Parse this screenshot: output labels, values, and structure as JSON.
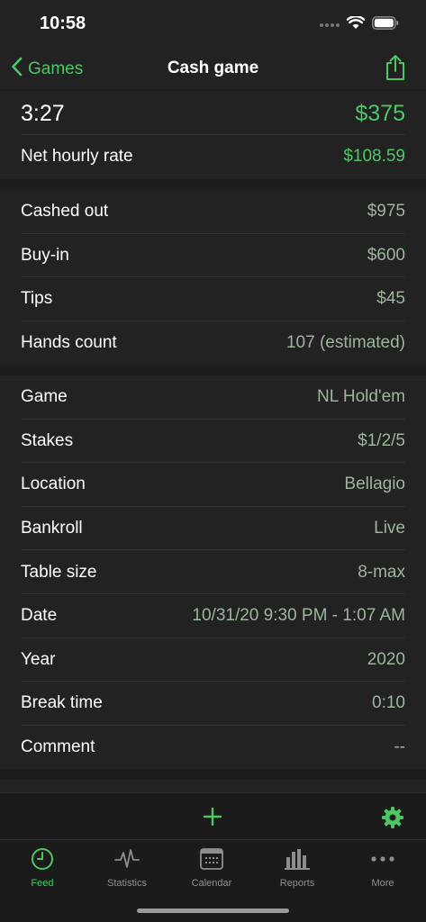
{
  "status_bar": {
    "time": "10:58"
  },
  "nav": {
    "back_label": "Games",
    "title": "Cash game"
  },
  "summary": {
    "duration": "3:27",
    "profit": "$375",
    "hourly_label": "Net hourly rate",
    "hourly_value": "$108.59"
  },
  "money": [
    {
      "label": "Cashed out",
      "value": "$975"
    },
    {
      "label": "Buy-in",
      "value": "$600"
    },
    {
      "label": "Tips",
      "value": "$45"
    },
    {
      "label": "Hands count",
      "value": "107 (estimated)"
    }
  ],
  "details": [
    {
      "label": "Game",
      "value": "NL Hold'em"
    },
    {
      "label": "Stakes",
      "value": "$1/2/5"
    },
    {
      "label": "Location",
      "value": "Bellagio"
    },
    {
      "label": "Bankroll",
      "value": "Live"
    },
    {
      "label": "Table size",
      "value": "8-max"
    },
    {
      "label": "Date",
      "value": "10/31/20 9:30 PM - 1:07 AM"
    },
    {
      "label": "Year",
      "value": "2020"
    },
    {
      "label": "Break time",
      "value": "0:10"
    },
    {
      "label": "Comment",
      "value": "--"
    }
  ],
  "tabs": [
    {
      "label": "Feed",
      "icon": "clock-icon",
      "active": true
    },
    {
      "label": "Statistics",
      "icon": "pulse-icon"
    },
    {
      "label": "Calendar",
      "icon": "calendar-icon"
    },
    {
      "label": "Reports",
      "icon": "bar-chart-icon"
    },
    {
      "label": "More",
      "icon": "ellipsis-icon"
    }
  ],
  "colors": {
    "accent": "#4cc764",
    "value_text": "#9db59a",
    "background": "#212221"
  }
}
